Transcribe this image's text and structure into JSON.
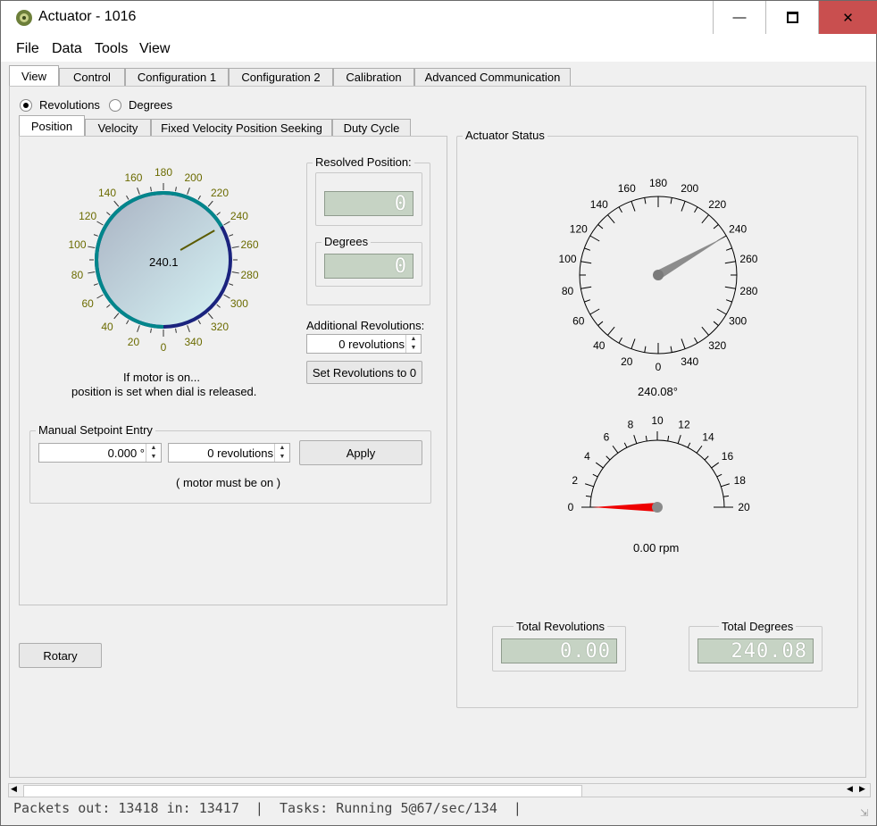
{
  "window": {
    "title": "Actuator - 1016"
  },
  "menu": [
    "File",
    "Data",
    "Tools",
    "View"
  ],
  "main_tabs": [
    "View",
    "Control",
    "Configuration 1",
    "Configuration 2",
    "Calibration",
    "Advanced Communication"
  ],
  "units": {
    "revolutions": "Revolutions",
    "degrees": "Degrees",
    "selected": "Revolutions"
  },
  "sub_tabs": [
    "Position",
    "Velocity",
    "Fixed Velocity Position Seeking",
    "Duty Cycle"
  ],
  "position": {
    "dial_value": "240.1",
    "dial_ticks": [
      "0",
      "20",
      "40",
      "60",
      "80",
      "100",
      "120",
      "140",
      "160",
      "180",
      "200",
      "220",
      "240",
      "260",
      "280",
      "300",
      "320",
      "340"
    ],
    "resolved_position_label": "Resolved Position:",
    "resolved_position_value": "0",
    "degrees_label": "Degrees",
    "degrees_value": "0",
    "additional_revolutions_label": "Additional Revolutions:",
    "additional_revolutions_value": "0 revolutions",
    "set_revolutions_button": "Set Revolutions to 0",
    "note_line1": "If motor is on...",
    "note_line2": "position is set when dial is released.",
    "manual_setpoint_label": "Manual Setpoint Entry",
    "setpoint_degrees": "0.000 °",
    "setpoint_revolutions": "0 revolutions",
    "apply_button": "Apply",
    "motor_note": "( motor must be on )"
  },
  "rotary_button": "Rotary",
  "status": {
    "title": "Actuator Status",
    "position_gauge_value": 240.08,
    "position_readout": "240.08°",
    "speed_gauge_value": 0,
    "speed_ticks": [
      "0",
      "2",
      "4",
      "6",
      "8",
      "10",
      "12",
      "14",
      "16",
      "18",
      "20"
    ],
    "speed_readout": "0.00 rpm",
    "total_revolutions_label": "Total Revolutions",
    "total_revolutions_value": "0.00",
    "total_degrees_label": "Total Degrees",
    "total_degrees_value": "240.08"
  },
  "statusbar": "Packets out: 13418 in: 13417  |  Tasks: Running 5@67/sec/134  |",
  "colors": {
    "close_button": "#c94f4f",
    "dial_ring": "#1a237e",
    "dial_teal": "#00868b",
    "speed_needle": "#ee0000"
  }
}
